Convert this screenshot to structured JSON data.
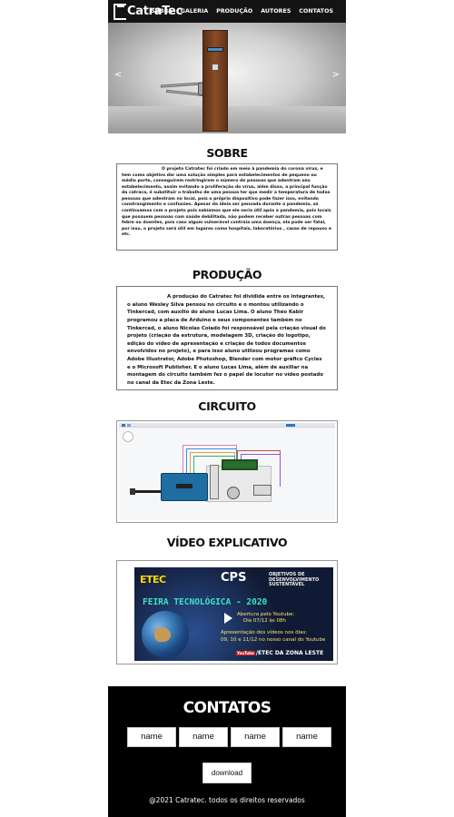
{
  "nav": {
    "logo_text": "CatraTec",
    "links": [
      "SOBRE",
      "GALERIA",
      "PRODUÇÃO",
      "AUTORES",
      "CONTATOS"
    ]
  },
  "hero": {
    "prev_arrow": "<",
    "next_arrow": ">"
  },
  "sobre": {
    "title": "SOBRE",
    "text": "O projeto Catratec foi criado em meio à pandemia do corona vírus, e tem como objetivo dar uma solução simples para estabelecimentos de pequeno ou médio porte, conseguirem restringirem o número de pessoas que adentram seu estabelecimento, assim evitando a proliferação do vírus, além disso, a principal função da catraca, é substituir o trabalho de uma pessoa ter que medir a temperatura de todas pessoas que adentram no local, pois o próprio dispositivo pode fazer isso, evitando constrangimento e confusões. Apesar da ideia ser pensada durante a pandemia, só continuamos com o projeto pois sabíamos que ele seria útil após a pandemia, pois  locais que possuem pessoas com saúde debilitada, não podem receber outras pessoas com febre ou doentes, pois caso algum vulnerável contraia uma doença, ela pode ser fatal, por isso, o projeto será útil em lugares como hospitais, laboratórios , casas de repouso e etc."
  },
  "producao": {
    "title": "PRODUÇÃO",
    "text": "A produção do Catratec foi dividida entre os integrantes, o aluno Wesley Silva pensou no circuito e o montou utilizando o Tinkercad, com auxílio do aluno Lucas Lima. O aluno Théo Kabir programou a placa de Arduino e seus componentes também no Tinkercad, o aluno Nicolas Coiado foi responsável pela criação visual do projeto (criação da estrutura, modelagem 3D, criação do logotipo, edição do vídeo de apresentação e criação de todos documentos envolvidos no projeto), e para isso aluno utilizou programas como Adobe Illustrator, Adobe Photoshop, Blender com motor gráfico Cycles e o Microsoft Publisher. E o aluno Lucas Lima, além de auxiliar na montagem do circuito também fez o papel de locutor no vídeo postado no canal da Etec da Zona Leste."
  },
  "circuito": {
    "title": "CIRCUITO"
  },
  "video": {
    "title": "VÍDEO EXPLICATIVO",
    "etec_logo": "ETEC",
    "cps_logo": "CPS",
    "ods_text": "OBJETIVOS DE DESENVOLVIMENTO SUSTENTÁVEL",
    "banner": "FEIRA TECNOLÓGICA - 2020",
    "line1": "Abertura pelo Youtube:",
    "line2": "Dia 07/12 às 08h",
    "line3": "Apresentação dos vídeos nos dias:",
    "line4": "09, 10 e 11/12 no nosso canal do Youtube",
    "yt_badge": "YouTube",
    "channel": "/ETEC DA ZONA LESTE"
  },
  "contact": {
    "title": "CONTATOS",
    "fields": [
      "name",
      "name",
      "name",
      "name"
    ],
    "download_label": "download",
    "copyright": "@2021 Catratec. todos os direitos reservados"
  }
}
